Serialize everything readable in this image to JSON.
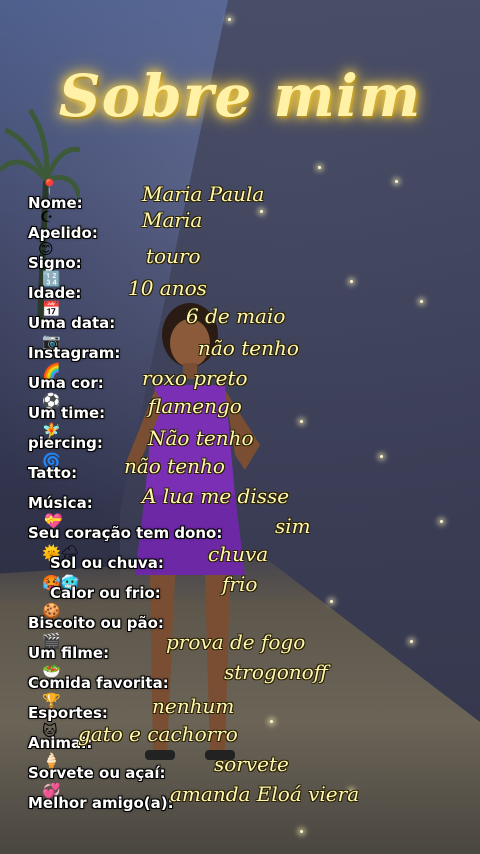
{
  "title": "Sobre mim",
  "fields": [
    {
      "icon": "pin-icon",
      "glyph": "📍",
      "label": "Nome:",
      "value": "Maria Paula"
    },
    {
      "icon": "moon-icon",
      "glyph": "☪",
      "label": "Apelido:",
      "value": "Maria"
    },
    {
      "icon": "smile-icon",
      "glyph": "😊",
      "label": "Signo:",
      "value": "touro"
    },
    {
      "icon": "numbers-icon",
      "glyph": "🔢",
      "label": "Idade:",
      "value": "10 anos"
    },
    {
      "icon": "calendar-icon",
      "glyph": "📅",
      "label": "Uma data:",
      "value": "6 de maio"
    },
    {
      "icon": "camera-icon",
      "glyph": "📷",
      "label": "Instagram:",
      "value": "não tenho"
    },
    {
      "icon": "rainbow-icon",
      "glyph": "🌈",
      "label": "Uma cor:",
      "value": "roxo preto"
    },
    {
      "icon": "soccer-ball-icon",
      "glyph": "⚽",
      "label": "Um time:",
      "value": "flamengo"
    },
    {
      "icon": "fairy-icon",
      "glyph": "🧚",
      "label": "piercing:",
      "value": "Não tenho"
    },
    {
      "icon": "wave-icon",
      "glyph": "🌀",
      "label": "Tatto:",
      "value": "não tenho"
    },
    {
      "icon": "music-icon",
      "glyph": "🎶",
      "label": "Música:",
      "value": "A lua me disse"
    },
    {
      "icon": "heart-icon",
      "glyph": "💝",
      "label": "Seu coração tem dono:",
      "value": "sim"
    },
    {
      "icon": "sun-rain-icon",
      "glyph": "🌞🌧",
      "label": "Sol ou chuva:",
      "value": "chuva"
    },
    {
      "icon": "hot-cold-icon",
      "glyph": "🥵🥶",
      "label": "Calor ou frio:",
      "value": "frio"
    },
    {
      "icon": "cookie-icon",
      "glyph": "🍪",
      "label": "Biscoito ou pão:",
      "value": ""
    },
    {
      "icon": "clapper-icon",
      "glyph": "🎬",
      "label": "Um filme:",
      "value": "prova de fogo"
    },
    {
      "icon": "food-icon",
      "glyph": "🥗",
      "label": "Comida favorita:",
      "value": "strogonoff"
    },
    {
      "icon": "trophy-icon",
      "glyph": "🏆",
      "label": "Esportes:",
      "value": "nenhum"
    },
    {
      "icon": "cat-icon",
      "glyph": "🐱",
      "label": "Animal:",
      "value": "gato e cachorro"
    },
    {
      "icon": "ice-cream-icon",
      "glyph": "🍦",
      "label": "Sorvete ou açaí:",
      "value": "sorvete"
    },
    {
      "icon": "hearts-icon",
      "glyph": "💞",
      "label": "Melhor amigo(a):",
      "value": "amanda Eloá viera"
    }
  ]
}
